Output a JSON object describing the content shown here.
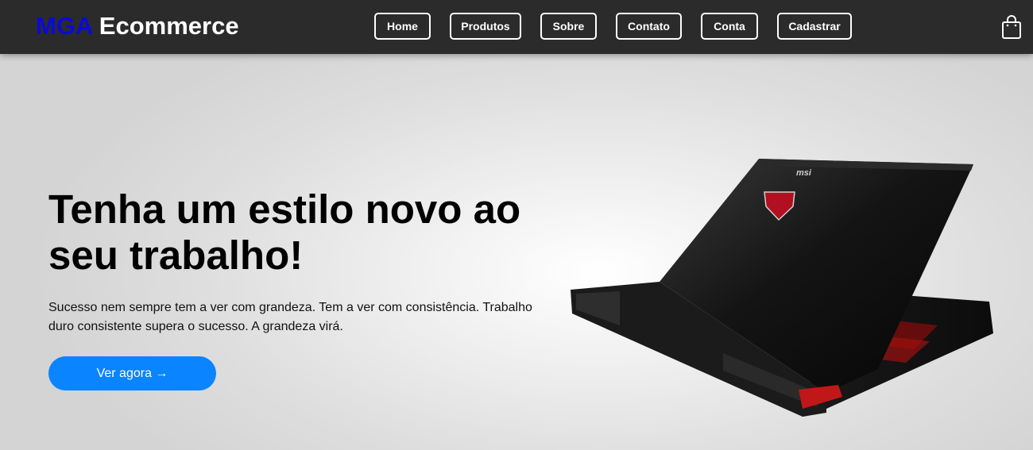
{
  "header": {
    "logo_brand": "MGA",
    "logo_rest": " Ecommerce",
    "nav": [
      {
        "label": "Home"
      },
      {
        "label": "Produtos"
      },
      {
        "label": "Sobre"
      },
      {
        "label": "Contato"
      },
      {
        "label": "Conta"
      },
      {
        "label": "Cadastrar"
      }
    ],
    "cart_icon": "shopping-bag-icon"
  },
  "hero": {
    "title": "Tenha um estilo novo ao seu trabalho!",
    "text": "Sucesso nem sempre tem a ver com grandeza. Tem a ver com consistência. Trabalho duro consistente supera o sucesso. A grandeza virá.",
    "cta_label": "Ver agora →",
    "image": "laptop-image",
    "laptop_brand": "msi"
  },
  "colors": {
    "header_bg": "#2b2b2b",
    "brand_blue": "#0a0ad8",
    "cta_blue": "#0a84ff"
  }
}
